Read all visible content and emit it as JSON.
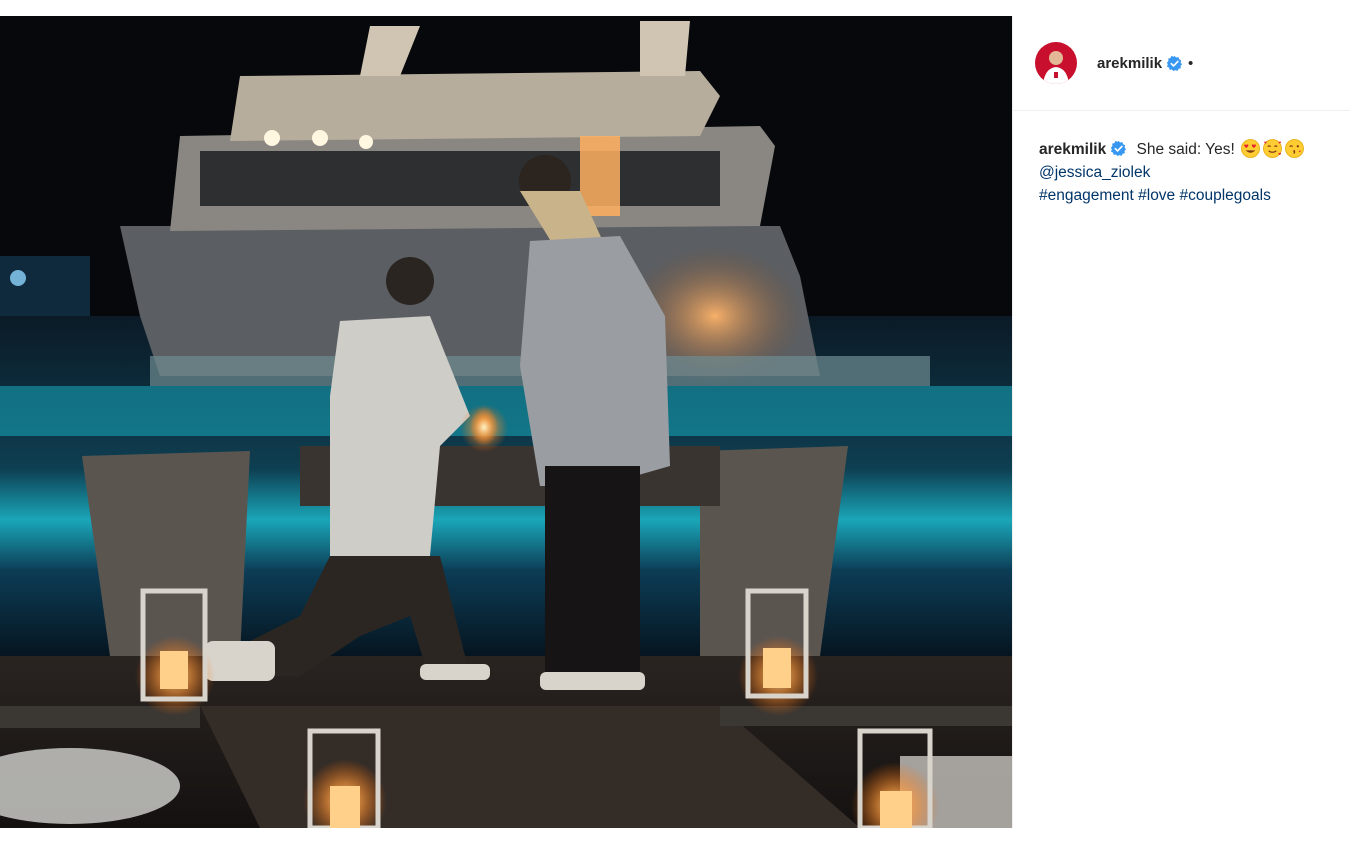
{
  "post": {
    "image_alt": "Man kneeling to propose on a candle-lit dock at night with a yacht behind"
  },
  "header": {
    "username": "arekmilik",
    "separator": "•"
  },
  "caption": {
    "username": "arekmilik",
    "text": "She said: Yes!",
    "emojis": [
      "heart-eyes-emoji",
      "smiling-face-with-hearts-emoji",
      "kissing-face-emoji"
    ],
    "mention": "@jessica_ziolek",
    "hashtags": [
      "#engagement",
      "#love",
      "#couplegoals"
    ]
  },
  "colors": {
    "verified_badge": "#3897f0",
    "link": "#003569",
    "divider": "#efefef"
  }
}
